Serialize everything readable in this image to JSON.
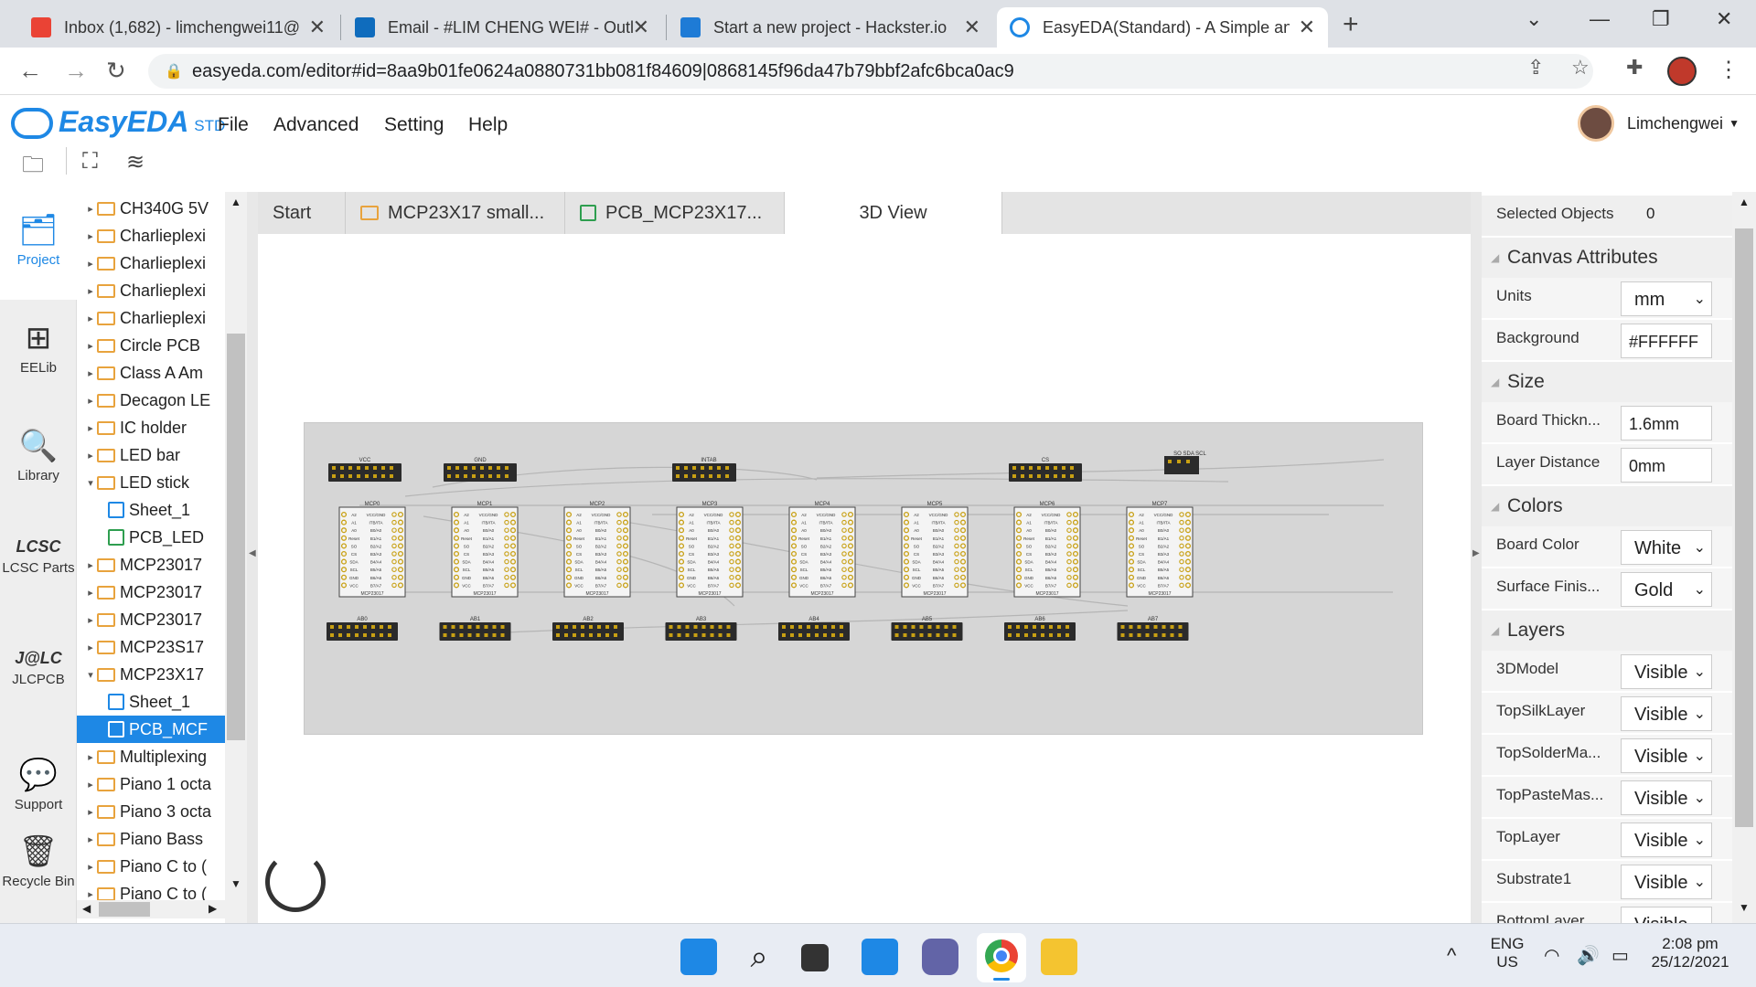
{
  "browser": {
    "tabs": [
      {
        "title": "Inbox (1,682) - limchengwei11@",
        "icon": "gmail-icon"
      },
      {
        "title": "Email - #LIM CHENG WEI# - Outl",
        "icon": "outlook-icon"
      },
      {
        "title": "Start a new project - Hackster.io",
        "icon": "hackster-icon"
      },
      {
        "title": "EasyEDA(Standard) - A Simple an",
        "icon": "easyeda-icon"
      }
    ],
    "url": "easyeda.com/editor#id=8aa9b01fe0624a0880731bb081f84609|0868145f96da47b79bbf2afc6bca0ac9"
  },
  "app": {
    "logo": "EasyEDA",
    "logo_suffix": "STD",
    "menu": [
      "File",
      "Advanced",
      "Setting",
      "Help"
    ],
    "user": "Limchengwei"
  },
  "leftbar": [
    {
      "label": "Project",
      "icon": "project-icon"
    },
    {
      "label": "EELib",
      "icon": "eelib-icon"
    },
    {
      "label": "Library",
      "icon": "library-icon"
    },
    {
      "label": "LCSC Parts",
      "icon": "lcsc-icon"
    },
    {
      "label": "JLCPCB",
      "icon": "jlcpcb-icon"
    },
    {
      "label": "Support",
      "icon": "support-icon"
    },
    {
      "label": "Recycle Bin",
      "icon": "recycle-bin-icon"
    }
  ],
  "tree": [
    {
      "label": "CH340G 5V",
      "type": "folder",
      "arrow": "▸"
    },
    {
      "label": "Charlieplexi",
      "type": "folder",
      "arrow": "▸"
    },
    {
      "label": "Charlieplexi",
      "type": "folder",
      "arrow": "▸"
    },
    {
      "label": "Charlieplexi",
      "type": "folder",
      "arrow": "▸"
    },
    {
      "label": "Charlieplexi",
      "type": "folder",
      "arrow": "▸"
    },
    {
      "label": "Circle PCB",
      "type": "folder",
      "arrow": "▸"
    },
    {
      "label": "Class A Am",
      "type": "folder",
      "arrow": "▸"
    },
    {
      "label": "Decagon LE",
      "type": "folder",
      "arrow": "▸"
    },
    {
      "label": "IC holder",
      "type": "folder",
      "arrow": "▸"
    },
    {
      "label": "LED bar",
      "type": "folder",
      "arrow": "▸"
    },
    {
      "label": "LED stick",
      "type": "folder",
      "arrow": "▾"
    },
    {
      "label": "Sheet_1",
      "type": "sheet",
      "arrow": ""
    },
    {
      "label": "PCB_LED",
      "type": "pcb",
      "arrow": ""
    },
    {
      "label": "MCP23017",
      "type": "folder",
      "arrow": "▸"
    },
    {
      "label": "MCP23017",
      "type": "folder",
      "arrow": "▸"
    },
    {
      "label": "MCP23017",
      "type": "folder",
      "arrow": "▸"
    },
    {
      "label": "MCP23S17",
      "type": "folder",
      "arrow": "▸"
    },
    {
      "label": "MCP23X17",
      "type": "folder",
      "arrow": "▾"
    },
    {
      "label": "Sheet_1",
      "type": "sheet",
      "arrow": ""
    },
    {
      "label": "PCB_MCF",
      "type": "pcb",
      "arrow": "",
      "selected": true
    },
    {
      "label": "Multiplexing",
      "type": "folder",
      "arrow": "▸"
    },
    {
      "label": "Piano 1 octa",
      "type": "folder",
      "arrow": "▸"
    },
    {
      "label": "Piano 3 octa",
      "type": "folder",
      "arrow": "▸"
    },
    {
      "label": "Piano Bass",
      "type": "folder",
      "arrow": "▸"
    },
    {
      "label": "Piano C to (",
      "type": "folder",
      "arrow": "▸"
    },
    {
      "label": "Piano C to (",
      "type": "folder",
      "arrow": "▸"
    }
  ],
  "doctabs": [
    {
      "label": "Start",
      "type": "start"
    },
    {
      "label": "MCP23X17 small...",
      "type": "folder"
    },
    {
      "label": "PCB_MCP23X17...",
      "type": "pcb"
    },
    {
      "label": "3D View",
      "type": "3d",
      "active": true
    }
  ],
  "board": {
    "top_headers": [
      "VCC",
      "GND",
      "INTAB",
      "CS",
      "SO SDA SCL"
    ],
    "modules": [
      "MCP0",
      "MCP1",
      "MCP2",
      "MCP3",
      "MCP4",
      "MCP5",
      "MCP6",
      "MCP7"
    ],
    "module_footer": "MCP23017",
    "pin_left": [
      "A2",
      "A1",
      "A0",
      "Reset",
      "SO",
      "CS",
      "SDA",
      "SCL",
      "GND",
      "VCC"
    ],
    "pin_right": [
      "VCC/GND",
      "ITB/ITA",
      "B0/A0",
      "B1/A1",
      "B2/A2",
      "B3/A3",
      "B4/A4",
      "B5/A5",
      "B6/A6",
      "B7/A7"
    ],
    "bottom_headers": [
      "AB0",
      "AB1",
      "AB2",
      "AB3",
      "AB4",
      "AB5",
      "AB6",
      "AB7"
    ]
  },
  "properties": {
    "selected_label": "Selected Objects",
    "selected_count": "0",
    "sections": {
      "canvas": "Canvas Attributes",
      "size": "Size",
      "colors": "Colors",
      "layers": "Layers"
    },
    "units_label": "Units",
    "units": "mm",
    "background_label": "Background",
    "background": "#FFFFFF",
    "thickness_label": "Board Thickn...",
    "thickness": "1.6mm",
    "distance_label": "Layer Distance",
    "distance": "0mm",
    "board_color_label": "Board Color",
    "board_color": "White",
    "surface_label": "Surface Finis...",
    "surface": "Gold",
    "layers": [
      {
        "label": "3DModel",
        "value": "Visible"
      },
      {
        "label": "TopSilkLayer",
        "value": "Visible"
      },
      {
        "label": "TopSolderMa...",
        "value": "Visible"
      },
      {
        "label": "TopPasteMas...",
        "value": "Visible"
      },
      {
        "label": "TopLayer",
        "value": "Visible"
      },
      {
        "label": "Substrate1",
        "value": "Visible"
      },
      {
        "label": "BottomLayer",
        "value": "Visible"
      }
    ]
  },
  "taskbar": {
    "lang": "ENG",
    "region": "US",
    "time": "2:08 pm",
    "date": "25/12/2021"
  },
  "colors": {
    "accent": "#1e88e5",
    "board": "#d6d6d6",
    "pin_gold": "#c8a013"
  }
}
